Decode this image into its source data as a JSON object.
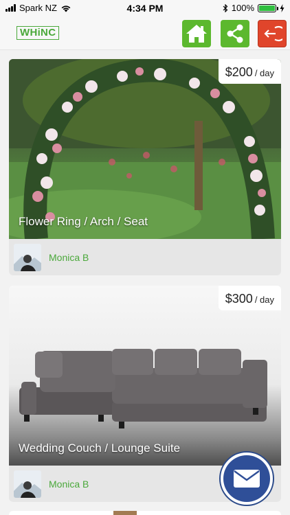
{
  "status_bar": {
    "carrier": "Spark NZ",
    "time": "4:34 PM",
    "battery_percent": "100%",
    "battery_level": 1.0
  },
  "header": {
    "logo_text": "WHiNC",
    "buttons": [
      {
        "name": "home",
        "icon": "home-icon",
        "color": "#5cb82e"
      },
      {
        "name": "share",
        "icon": "share-icon",
        "color": "#5cb82e"
      },
      {
        "name": "logout",
        "icon": "logout-icon",
        "color": "#e0452b"
      }
    ]
  },
  "listings": [
    {
      "price": "$200",
      "price_unit": "/ day",
      "title": "Flower Ring / Arch / Seat",
      "owner": "Monica B"
    },
    {
      "price": "$300",
      "price_unit": "/ day",
      "title": "Wedding Couch / Lounge Suite",
      "owner": "Monica B"
    }
  ],
  "fab": {
    "icon": "mail-icon",
    "color": "#2f4f98"
  },
  "colors": {
    "brand_green": "#4aa83a",
    "logout_red": "#e0452b",
    "mail_blue": "#2f4f98"
  }
}
